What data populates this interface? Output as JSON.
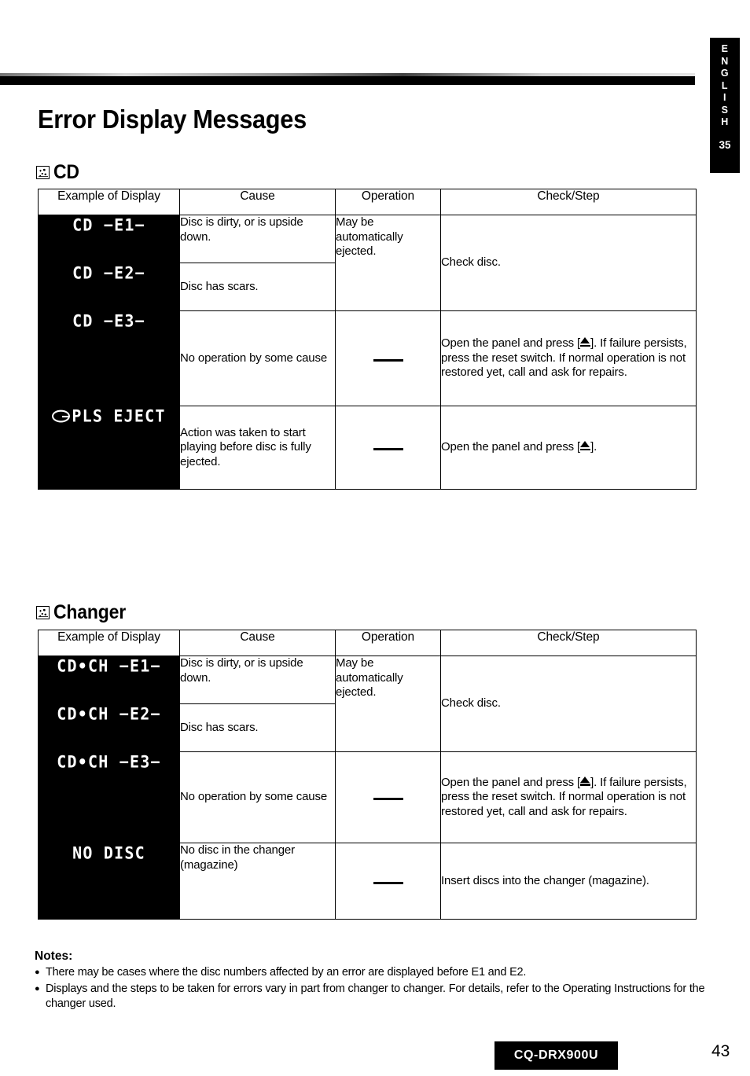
{
  "side_tab": {
    "language_letters": [
      "E",
      "N",
      "G",
      "L",
      "I",
      "S",
      "H"
    ],
    "tab_number": "35"
  },
  "page_title": "Error Display Messages",
  "sections": [
    {
      "icon": "display-panel-icon",
      "heading": "CD",
      "table": {
        "headers": [
          "Example of Display",
          "Cause",
          "Operation",
          "Check/Step"
        ],
        "rows": [
          {
            "display_prefix": "CD",
            "display_code": "−E1−",
            "display_full": "CD  −E1−",
            "cause": "Disc is dirty, or is upside down.",
            "operation": "May be automatically ejected.",
            "check": "Check disc."
          },
          {
            "display_prefix": "CD",
            "display_code": "−E2−",
            "display_full": "CD  −E2−",
            "cause": "Disc has scars."
          },
          {
            "display_prefix": "CD",
            "display_code": "−E3−",
            "display_full": "CD  −E3−",
            "cause": "No operation by some cause",
            "operation": "—",
            "check_before": "Open the panel and press [",
            "check_after": "]. If failure persists, press the reset switch. If normal operation is not restored yet, call and ask for repairs."
          },
          {
            "display_icon": "disc-eject-icon",
            "display_full": "PLS EJECT",
            "cause": "Action was taken to start playing before disc is fully ejected.",
            "operation": "—",
            "check_before": "Open the panel and press [",
            "check_after": "]."
          }
        ]
      }
    },
    {
      "icon": "display-panel-icon",
      "heading": "Changer",
      "table": {
        "headers": [
          "Example of Display",
          "Cause",
          "Operation",
          "Check/Step"
        ],
        "rows": [
          {
            "display_full": "CD•CH  −E1−",
            "cause": "Disc is dirty, or is upside down.",
            "operation": "May be automatically ejected.",
            "check": "Check disc."
          },
          {
            "display_full": "CD•CH  −E2−",
            "cause": "Disc has scars."
          },
          {
            "display_full": "CD•CH  −E3−",
            "cause": "No operation by some cause",
            "operation": "—",
            "check_before": "Open the panel and press [",
            "check_after": "]. If failure persists, press the reset switch. If normal operation is not restored yet, call and ask for repairs."
          },
          {
            "display_full": "NO  DISC",
            "cause": "No disc in the changer (magazine)",
            "operation": "—",
            "check": "Insert discs into the changer (magazine)."
          }
        ]
      }
    }
  ],
  "notes": {
    "title": "Notes:",
    "items": [
      "There may be cases where the disc numbers affected by an error are displayed before E1 and E2.",
      "Displays and the steps to be taken for errors vary in part from changer to changer. For details, refer to the Operating Instructions for the changer used."
    ]
  },
  "footer": {
    "model": "CQ-DRX900U",
    "page_number": "43"
  }
}
